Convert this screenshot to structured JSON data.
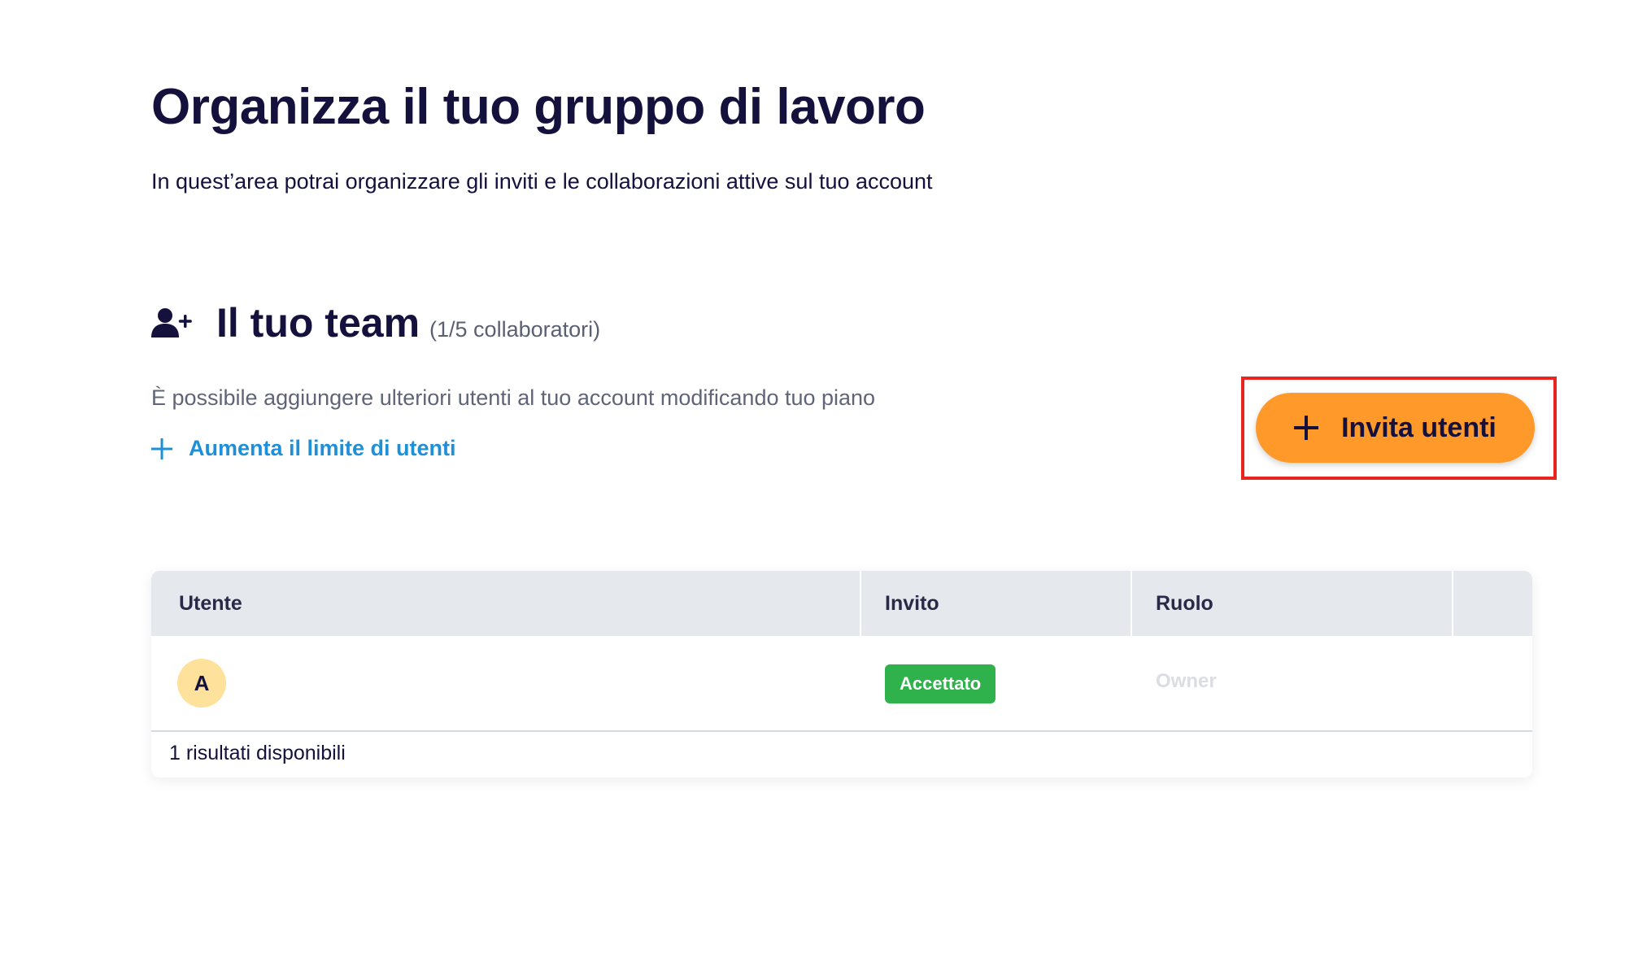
{
  "header": {
    "title": "Organizza il tuo gruppo di lavoro",
    "subtitle": "In quest’area potrai organizzare gli inviti e le collaborazioni attive sul tuo account"
  },
  "team": {
    "icon": "user-plus-icon",
    "title": "Il tuo team",
    "count": "(1/5 collaboratori)",
    "note": "È possibile aggiungere ulteriori utenti al tuo account modificando tuo piano",
    "increase_link": "Aumenta il limite di utenti",
    "invite_button": "Invita utenti"
  },
  "table": {
    "columns": [
      "Utente",
      "Invito",
      "Ruolo",
      ""
    ],
    "rows": [
      {
        "avatar": "A",
        "invite_status": "Accettato",
        "role": "Owner"
      }
    ],
    "results_text": "1 risultati disponibili"
  },
  "colors": {
    "primary_text": "#14113d",
    "accent_orange": "#ff9a2a",
    "link_blue": "#1e90d8",
    "success_green": "#2fb14c",
    "highlight_red": "#e8261f"
  }
}
